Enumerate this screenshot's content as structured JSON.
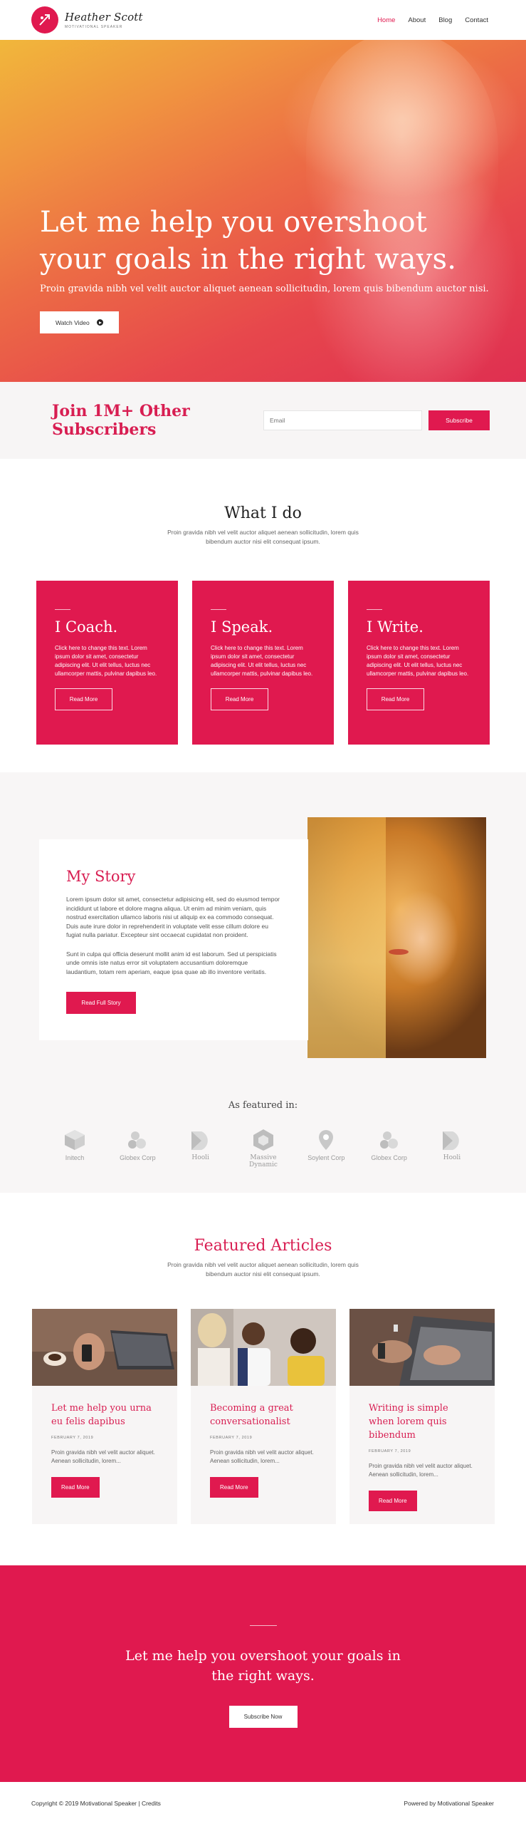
{
  "header": {
    "brand_name": "Heather Scott",
    "brand_tagline": "MOTIVATIONAL SPEAKER",
    "nav": [
      {
        "label": "Home",
        "active": true
      },
      {
        "label": "About"
      },
      {
        "label": "Blog"
      },
      {
        "label": "Contact"
      }
    ]
  },
  "hero": {
    "title": "Let me help you overshoot your goals in the right ways.",
    "subtitle": "Proin gravida nibh vel velit auctor aliquet aenean sollicitudin, lorem quis bibendum auctor nisi.",
    "button_label": "Watch Video",
    "button_icon": "play-circle-icon"
  },
  "subscribe": {
    "title": "Join 1M+ Other Subscribers",
    "email_placeholder": "Email",
    "button_label": "Subscribe"
  },
  "what_i_do": {
    "title": "What I do",
    "subtitle": "Proin gravida nibh vel velit auctor aliquet aenean sollicitudin, lorem quis bibendum auctor nisi elit consequat ipsum.",
    "cards": [
      {
        "title": "I Coach.",
        "text": "Click here to change this text. Lorem ipsum dolor sit amet, consectetur adipiscing elit. Ut elit tellus, luctus nec ullamcorper mattis, pulvinar dapibus leo.",
        "button": "Read More"
      },
      {
        "title": "I Speak.",
        "text": "Click here to change this text. Lorem ipsum dolor sit amet, consectetur adipiscing elit. Ut elit tellus, luctus nec ullamcorper mattis, pulvinar dapibus leo.",
        "button": "Read More"
      },
      {
        "title": "I Write.",
        "text": "Click here to change this text. Lorem ipsum dolor sit amet, consectetur adipiscing elit. Ut elit tellus, luctus nec ullamcorper mattis, pulvinar dapibus leo.",
        "button": "Read More"
      }
    ]
  },
  "story": {
    "title": "My Story",
    "paragraph1": "Lorem ipsum dolor sit amet, consectetur adipisicing elit, sed do eiusmod tempor incididunt ut labore et dolore magna aliqua. Ut enim ad minim veniam, quis nostrud exercitation ullamco laboris nisi ut aliquip ex ea commodo consequat. Duis aute irure dolor in reprehenderit in voluptate velit esse cillum dolore eu fugiat nulla pariatur. Excepteur sint occaecat cupidatat non proident.",
    "paragraph2": "Sunt in culpa qui officia deserunt mollit anim id est laborum. Sed ut perspiciatis unde omnis iste natus error sit voluptatem accusantium doloremque laudantium, totam rem aperiam, eaque ipsa quae ab illo inventore veritatis.",
    "button_label": "Read Full Story"
  },
  "featured_in": {
    "label": "As featured in:",
    "logos": [
      {
        "name": "Initech",
        "icon": "cube-icon"
      },
      {
        "name": "Globex Corp",
        "icon": "circles-icon"
      },
      {
        "name": "Hooli",
        "icon": "leaf-icon"
      },
      {
        "name": "Massive Dynamic",
        "icon": "hexagon-icon"
      },
      {
        "name": "Soylent Corp",
        "icon": "pin-icon"
      },
      {
        "name": "Globex Corp",
        "icon": "circles-icon"
      },
      {
        "name": "Hooli",
        "icon": "leaf-icon"
      }
    ]
  },
  "articles": {
    "title": "Featured Articles",
    "subtitle": "Proin gravida nibh vel velit auctor aliquet aenean sollicitudin, lorem quis bibendum auctor nisi elit consequat ipsum.",
    "items": [
      {
        "title": "Let me help you urna eu felis dapibus",
        "date": "FEBRUARY 7, 2019",
        "excerpt": "Proin gravida nibh vel velit auctor aliquet. Aenean sollicitudin, lorem...",
        "button": "Read More"
      },
      {
        "title": "Becoming a great conversationalist",
        "date": "FEBRUARY 7, 2019",
        "excerpt": "Proin gravida nibh vel velit auctor aliquet. Aenean sollicitudin, lorem...",
        "button": "Read More"
      },
      {
        "title": "Writing is simple when lorem quis bibendum",
        "date": "FEBRUARY 7, 2019",
        "excerpt": "Proin gravida nibh vel velit auctor aliquet. Aenean sollicitudin, lorem...",
        "button": "Read More"
      }
    ]
  },
  "cta": {
    "title": "Let me help you overshoot your goals in the right ways.",
    "button_label": "Subscribe Now"
  },
  "footer": {
    "left": "Copyright © 2019 Motivational Speaker | Credits",
    "right": "Powered by Motivational Speaker"
  },
  "colors": {
    "accent": "#e0194f",
    "accent_text": "#d81e52",
    "light_bg": "#f7f5f5"
  }
}
